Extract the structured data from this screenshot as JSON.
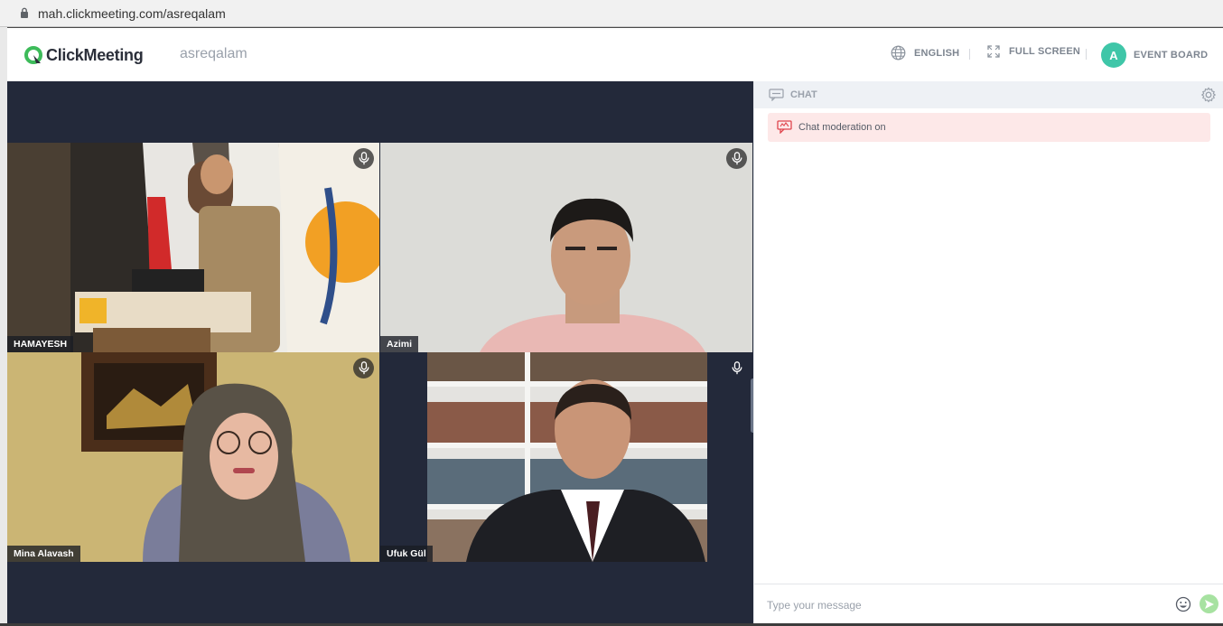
{
  "browser": {
    "url": "mah.clickmeeting.com/asreqalam",
    "lock_icon": "lock-icon"
  },
  "header": {
    "logo_text": "ClickMeeting",
    "room_name": "asreqalam",
    "language_label": "ENGLISH",
    "fullscreen_label": "FULL SCREEN",
    "avatar_initial": "A",
    "event_board_label": "EVENT BOARD",
    "accent_color": "#3fc6a8"
  },
  "stage": {
    "participants": [
      {
        "name": "HAMAYESH",
        "mic_muted": false
      },
      {
        "name": "Azimi",
        "mic_muted": false
      },
      {
        "name": "Mina Alavash",
        "mic_muted": false
      },
      {
        "name": "Ufuk Gül",
        "mic_muted": false
      }
    ]
  },
  "chat": {
    "title": "CHAT",
    "moderation_notice": "Chat moderation on",
    "input_placeholder": "Type your message",
    "send_color": "#a7e2a1",
    "notice_color": "#fde8e8"
  }
}
